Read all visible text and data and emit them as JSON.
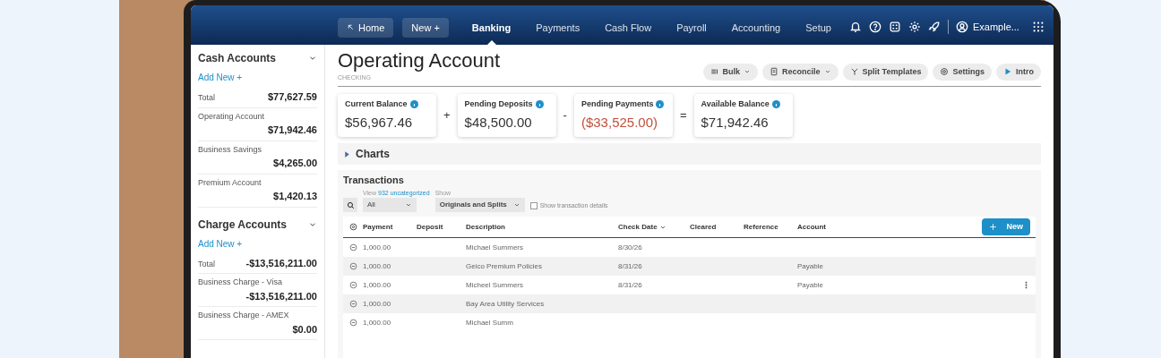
{
  "nav": {
    "home": "Home",
    "new": "New +",
    "tabs": [
      {
        "label": "Banking",
        "selected": true
      },
      {
        "label": "Payments",
        "selected": false
      },
      {
        "label": "Cash Flow",
        "selected": false
      },
      {
        "label": "Payroll",
        "selected": false
      },
      {
        "label": "Accounting",
        "selected": false
      },
      {
        "label": "Setup",
        "selected": false
      }
    ],
    "user": "Example..."
  },
  "sidebar": {
    "groups": [
      {
        "title": "Cash Accounts",
        "add_new": "Add New +",
        "items": [
          {
            "label": "Total",
            "value": "$77,627.59",
            "kind": "inline"
          },
          {
            "label": "Operating Account",
            "value": "$71,942.46",
            "kind": "stacked"
          },
          {
            "label": "Business Savings",
            "value": "$4,265.00",
            "kind": "stacked"
          },
          {
            "label": "Premium Account",
            "value": "$1,420.13",
            "kind": "stacked"
          }
        ]
      },
      {
        "title": "Charge Accounts",
        "add_new": "Add New +",
        "items": [
          {
            "label": "Total",
            "value": "-$13,516,211.00",
            "kind": "inline"
          },
          {
            "label": "Business Charge - Visa",
            "value": "-$13,516,211.00",
            "kind": "stacked"
          },
          {
            "label": "Business Charge - AMEX",
            "value": "$0.00",
            "kind": "stacked"
          }
        ]
      }
    ]
  },
  "page": {
    "title": "Operating Account",
    "subtitle": "CHECKING",
    "toolbar": [
      {
        "label": "Bulk",
        "kind": "bulk",
        "dropdown": true
      },
      {
        "label": "Reconcile",
        "kind": "reconcile",
        "dropdown": true
      },
      {
        "label": "Split Templates",
        "kind": "split",
        "dropdown": false
      },
      {
        "label": "Settings",
        "kind": "settings",
        "dropdown": false
      },
      {
        "label": "Intro",
        "kind": "intro",
        "dropdown": false
      }
    ],
    "balances": [
      {
        "label": "Current Balance",
        "value": "$56,967.46",
        "negative": false,
        "operator": "+"
      },
      {
        "label": "Pending Deposits",
        "value": "$48,500.00",
        "negative": false,
        "operator": "-"
      },
      {
        "label": "Pending Payments",
        "value": "($33,525.00)",
        "negative": true,
        "operator": "="
      },
      {
        "label": "Available Balance",
        "value": "$71,942.46",
        "negative": false
      }
    ],
    "charts": {
      "label": "Charts",
      "expanded": false
    }
  },
  "transactions": {
    "title": "Transactions",
    "view_label": "View",
    "uncategorized_link": "932 uncategorized",
    "filter": {
      "value": "All"
    },
    "show_label": "Show",
    "show": {
      "value": "Originals and Splits"
    },
    "details_checkbox": {
      "label": "Show transaction details",
      "checked": false
    },
    "new_button": "New",
    "columns": [
      "Payment",
      "Deposit",
      "Description",
      "Check Date",
      "Cleared",
      "Reference",
      "Account"
    ],
    "rows": [
      {
        "payment": "1,000.00",
        "description": "Michael Summers",
        "check_date": "8/30/26",
        "account": "",
        "menu": false
      },
      {
        "payment": "1,000.00",
        "description": "Geico Premium Policies",
        "check_date": "8/31/26",
        "account": "Payable",
        "menu": false
      },
      {
        "payment": "1,000.00",
        "description": "Micheel Summers",
        "check_date": "8/31/26",
        "account": "Payable",
        "menu": true
      },
      {
        "payment": "1,000.00",
        "description": "Bay Area Utility Services",
        "check_date": "",
        "account": "",
        "menu": false
      },
      {
        "payment": "1,000.00",
        "description": "Michael Summ",
        "check_date": "",
        "account": "",
        "menu": false
      }
    ]
  }
}
